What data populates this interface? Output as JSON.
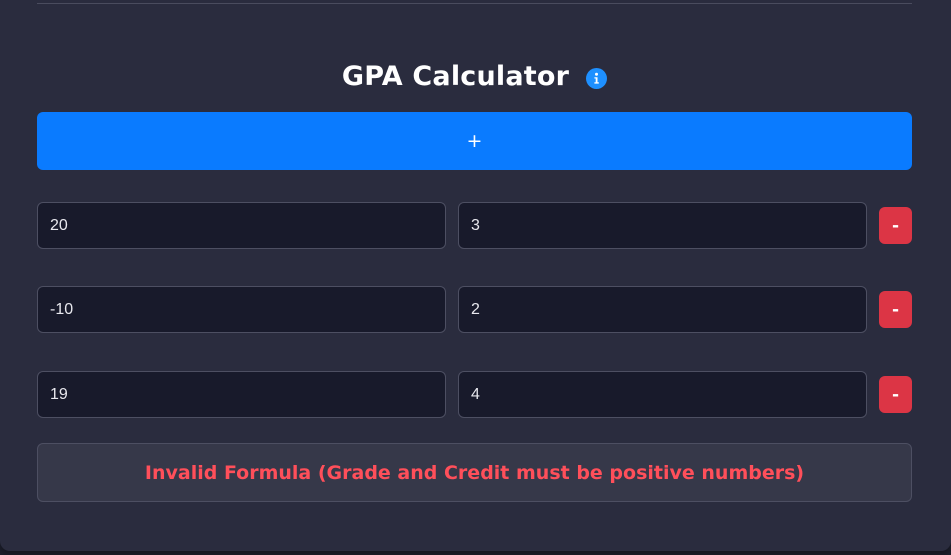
{
  "header": {
    "title": "GPA Calculator",
    "info_icon": "info-icon"
  },
  "add_button": {
    "label": "+"
  },
  "courses": [
    {
      "grade": "20",
      "credit": "3",
      "remove_label": "-"
    },
    {
      "grade": "-10",
      "credit": "2",
      "remove_label": "-"
    },
    {
      "grade": "19",
      "credit": "4",
      "remove_label": "-"
    }
  ],
  "result": {
    "message": "Invalid Formula (Grade and Credit must be positive numbers)"
  },
  "colors": {
    "background": "#2a2c3e",
    "accent": "#0a7bff",
    "danger": "#dc3545",
    "error_text": "#ff4f5a",
    "info": "#1e90ff"
  }
}
